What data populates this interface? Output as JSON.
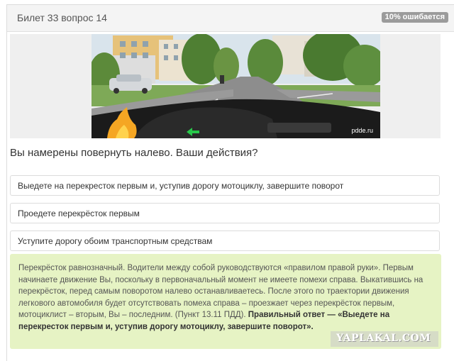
{
  "header": {
    "title": "Билет 33 вопрос 14",
    "badge": "10% ошибается"
  },
  "image": {
    "watermark": "pdde.ru"
  },
  "question": "Вы намерены повернуть налево. Ваши действия?",
  "answers": [
    "Выедете на перекресток первым и, уступив дорогу мотоциклу, завершите поворот",
    "Проедете перекрёсток первым",
    "Уступите дорогу обоим транспортным средствам"
  ],
  "explanation": {
    "text": "Перекрёсток равнозначный. Водители между собой руководствуются «правилом правой руки». Первым начинаете движение Вы, поскольку в первоначальный момент не имеете помехи справа. Выкатившись на перекрёсток, перед самым поворотом налево останавливаетесь. После этого по траектории движения легкового автомобиля будет отсутствовать помеха справа – проезжает через перекрёсток первым, мотоциклист – вторым, Вы – последним. (Пункт 13.11 ПДД). ",
    "answer": "Правильный ответ — «Выедете на перекресток первым и, уступив дорогу мотоциклу, завершите поворот»."
  },
  "site_watermark": "YAPLAKAL.COM",
  "colors": {
    "badge": "#9b9b9b",
    "explanation_bg": "#e6f3c4",
    "header_bg": "#f4f4f4"
  }
}
